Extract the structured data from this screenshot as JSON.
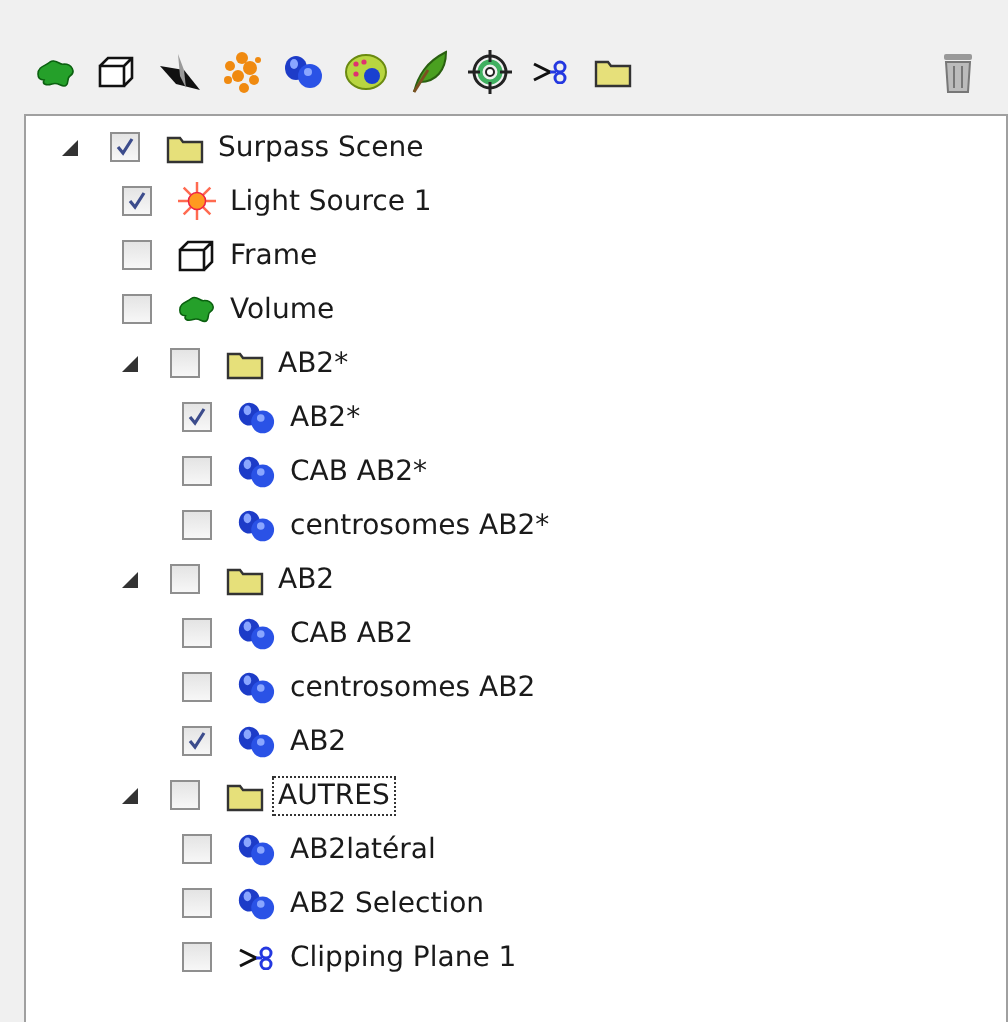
{
  "toolbar": {
    "tools": [
      {
        "kind": "volume"
      },
      {
        "kind": "frame"
      },
      {
        "kind": "plane"
      },
      {
        "kind": "spots"
      },
      {
        "kind": "surface"
      },
      {
        "kind": "cells"
      },
      {
        "kind": "filament"
      },
      {
        "kind": "reference"
      },
      {
        "kind": "clip"
      },
      {
        "kind": "folder"
      }
    ],
    "delete": {
      "kind": "trash"
    }
  },
  "tree": [
    {
      "label": "Surpass Scene",
      "kind": "folder",
      "checked": true,
      "expanded": true,
      "focused": false,
      "children": [
        {
          "label": "Light Source 1",
          "kind": "light",
          "checked": true,
          "focused": false
        },
        {
          "label": "Frame",
          "kind": "frame",
          "checked": false,
          "focused": false
        },
        {
          "label": "Volume",
          "kind": "volume",
          "checked": false,
          "focused": false
        },
        {
          "label": "AB2*",
          "kind": "folder",
          "checked": false,
          "expanded": true,
          "focused": false,
          "children": [
            {
              "label": "AB2*",
              "kind": "surface",
              "checked": true,
              "focused": false
            },
            {
              "label": "CAB AB2*",
              "kind": "surface",
              "checked": false,
              "focused": false
            },
            {
              "label": "centrosomes AB2*",
              "kind": "surface",
              "checked": false,
              "focused": false
            }
          ]
        },
        {
          "label": "AB2",
          "kind": "folder",
          "checked": false,
          "expanded": true,
          "focused": false,
          "children": [
            {
              "label": "CAB AB2",
              "kind": "surface",
              "checked": false,
              "focused": false
            },
            {
              "label": "centrosomes AB2",
              "kind": "surface",
              "checked": false,
              "focused": false
            },
            {
              "label": "AB2",
              "kind": "surface",
              "checked": true,
              "focused": false
            }
          ]
        },
        {
          "label": "AUTRES",
          "kind": "folder",
          "checked": false,
          "expanded": true,
          "focused": true,
          "children": [
            {
              "label": "AB2latéral",
              "kind": "surface",
              "checked": false,
              "focused": false
            },
            {
              "label": "AB2 Selection",
              "kind": "surface",
              "checked": false,
              "focused": false
            },
            {
              "label": "Clipping Plane 1",
              "kind": "clip",
              "checked": false,
              "focused": false
            }
          ]
        }
      ]
    }
  ]
}
